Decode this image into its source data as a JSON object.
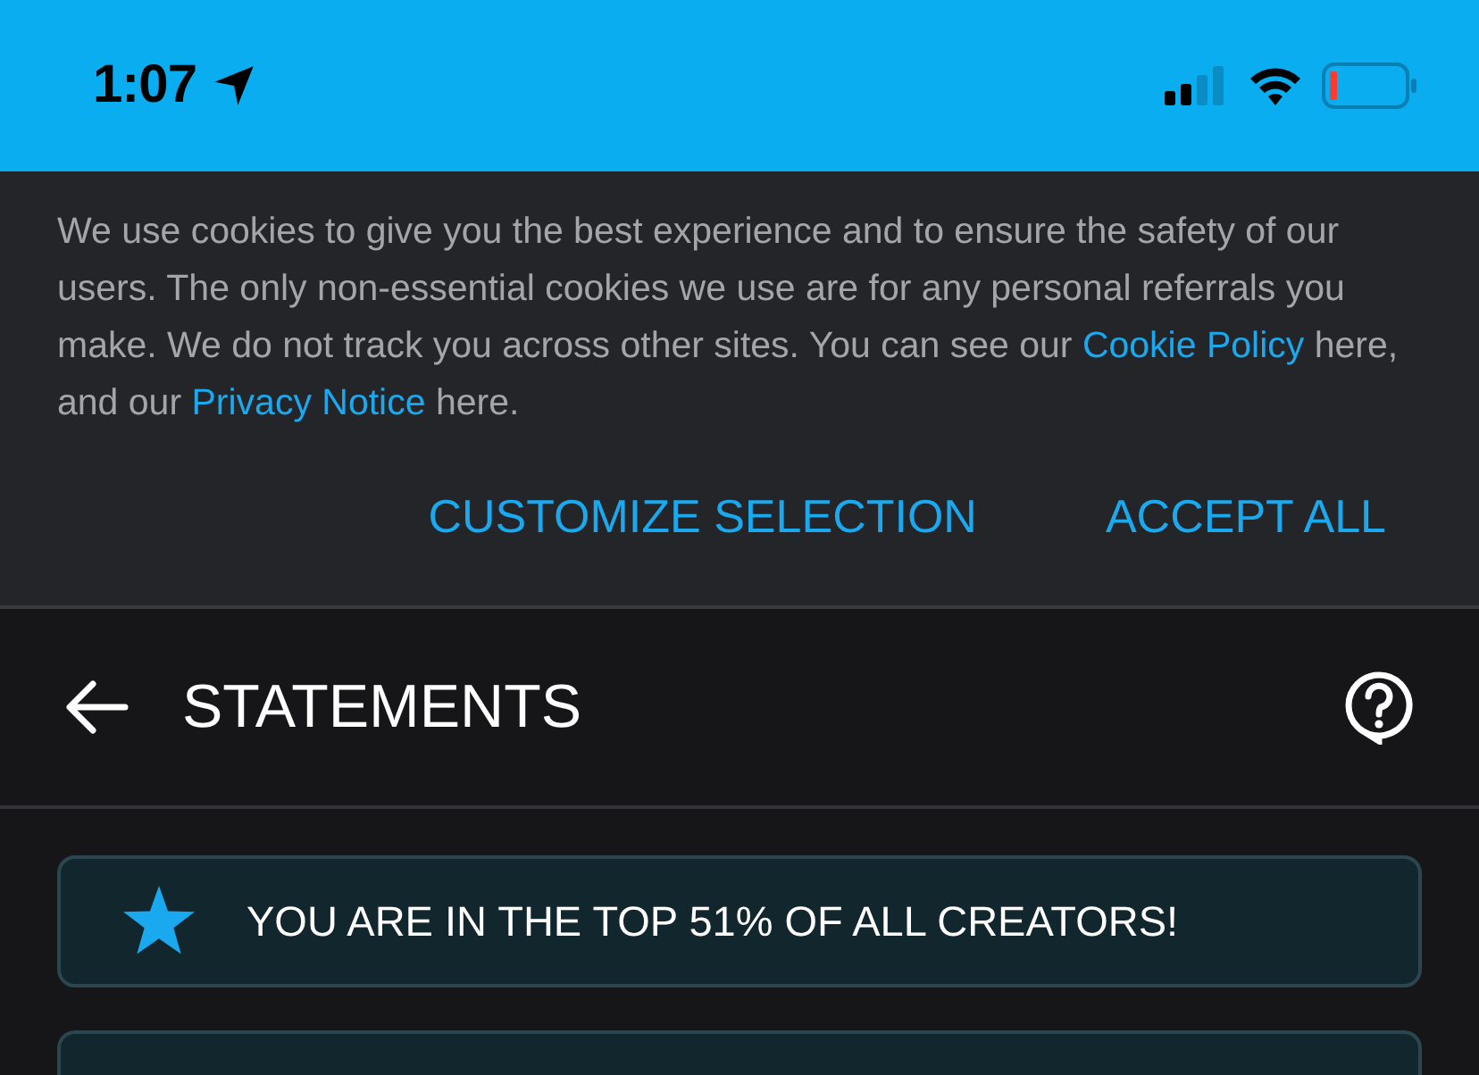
{
  "status_bar": {
    "time": "1:07"
  },
  "cookie_banner": {
    "message": [
      {
        "kind": "text",
        "text": "We use cookies to give you the best experience and to ensure the safety of our users. The only non-essential cookies we use are for any personal referrals you make. We do not track you across other sites. You can see our "
      },
      {
        "kind": "link",
        "text": "Cookie Policy"
      },
      {
        "kind": "text",
        "text": " here, and our "
      },
      {
        "kind": "link",
        "text": "Privacy Notice"
      },
      {
        "kind": "text",
        "text": " here."
      }
    ],
    "buttons": [
      "CUSTOMIZE SELECTION",
      "ACCEPT ALL"
    ]
  },
  "header": {
    "title": "STATEMENTS"
  },
  "rank_banner": {
    "text": "YOU ARE IN THE TOP 51% OF ALL CREATORS!"
  }
}
